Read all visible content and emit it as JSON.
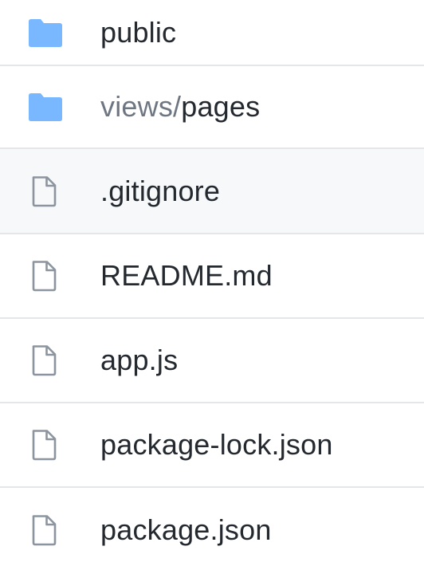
{
  "colors": {
    "folder_icon": "#79b8ff",
    "file_icon_stroke": "#8c959f",
    "text": "#24292f",
    "muted_text": "#6e7781",
    "divider": "#e4e6e9",
    "hover_row": "#f6f8fa"
  },
  "entries": [
    {
      "type": "folder",
      "icon": "folder-icon",
      "prefix": "",
      "name": "public"
    },
    {
      "type": "folder",
      "icon": "folder-icon",
      "prefix": "views/",
      "name": "pages"
    },
    {
      "type": "file",
      "icon": "file-icon",
      "prefix": "",
      "name": ".gitignore",
      "hovered": true
    },
    {
      "type": "file",
      "icon": "file-icon",
      "prefix": "",
      "name": "README.md"
    },
    {
      "type": "file",
      "icon": "file-icon",
      "prefix": "",
      "name": "app.js"
    },
    {
      "type": "file",
      "icon": "file-icon",
      "prefix": "",
      "name": "package-lock.json"
    },
    {
      "type": "file",
      "icon": "file-icon",
      "prefix": "",
      "name": "package.json"
    }
  ]
}
